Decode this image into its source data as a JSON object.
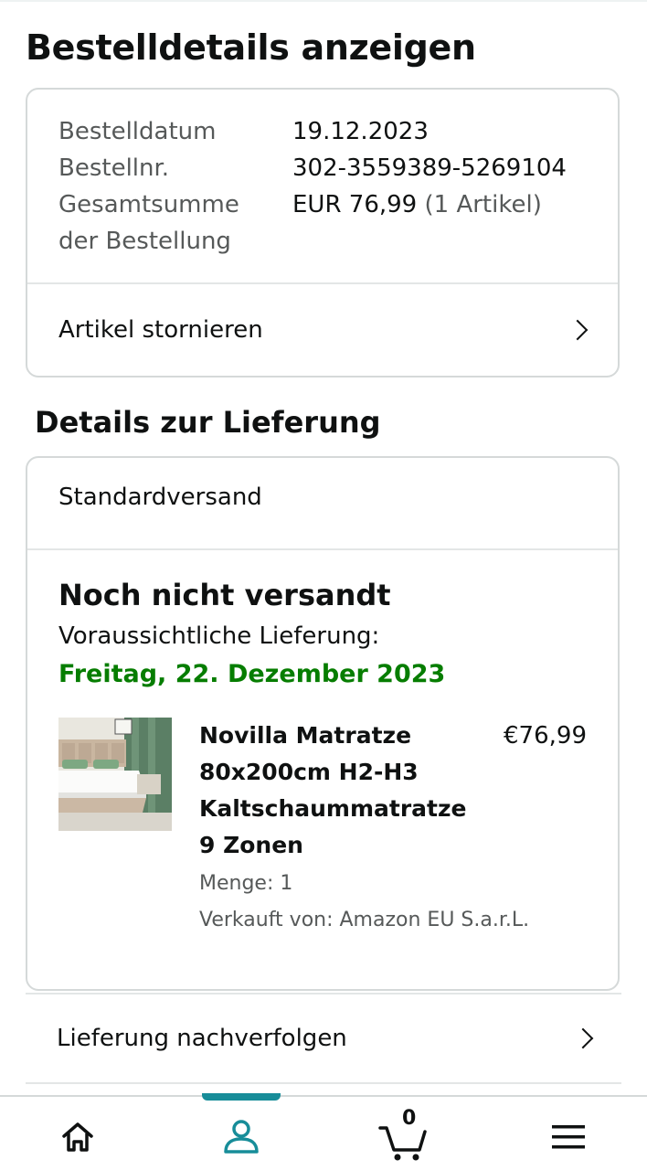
{
  "page": {
    "title": "Bestelldetails anzeigen"
  },
  "order_summary": {
    "rows": [
      {
        "label": "Bestelldatum",
        "value": "19.12.2023"
      },
      {
        "label": "Bestellnr.",
        "value": "302-3559389-5269104"
      },
      {
        "label": "Gesamtsumme der Bestellung",
        "value": "EUR 76,99",
        "value_suffix": "(1 Artikel)"
      }
    ],
    "cancel_label": "Artikel stornieren"
  },
  "delivery": {
    "section_title": "Details zur Lieferung",
    "shipping_method": "Standardversand",
    "status": "Noch nicht versandt",
    "eta_label": "Voraussichtliche Lieferung:",
    "eta_date": "Freitag, 22. Dezember 2023",
    "product": {
      "name": "Novilla Matratze 80x200cm H2-H3 Kaltschaummatratze 9 Zonen",
      "price": "€76,99",
      "quantity": "Menge: 1",
      "seller": "Verkauft von: Amazon EU S.a.r.L."
    },
    "track_label": "Lieferung nachverfolgen"
  },
  "bottom_nav": {
    "items": [
      {
        "icon": "home-icon"
      },
      {
        "icon": "account-icon",
        "active": true
      },
      {
        "icon": "cart-icon",
        "badge": "0"
      },
      {
        "icon": "menu-icon"
      }
    ]
  },
  "colors": {
    "accent": "#178d99",
    "eta_green": "#067d00",
    "text": "#0f1111",
    "muted": "#565959",
    "border": "#d5d9d9"
  }
}
